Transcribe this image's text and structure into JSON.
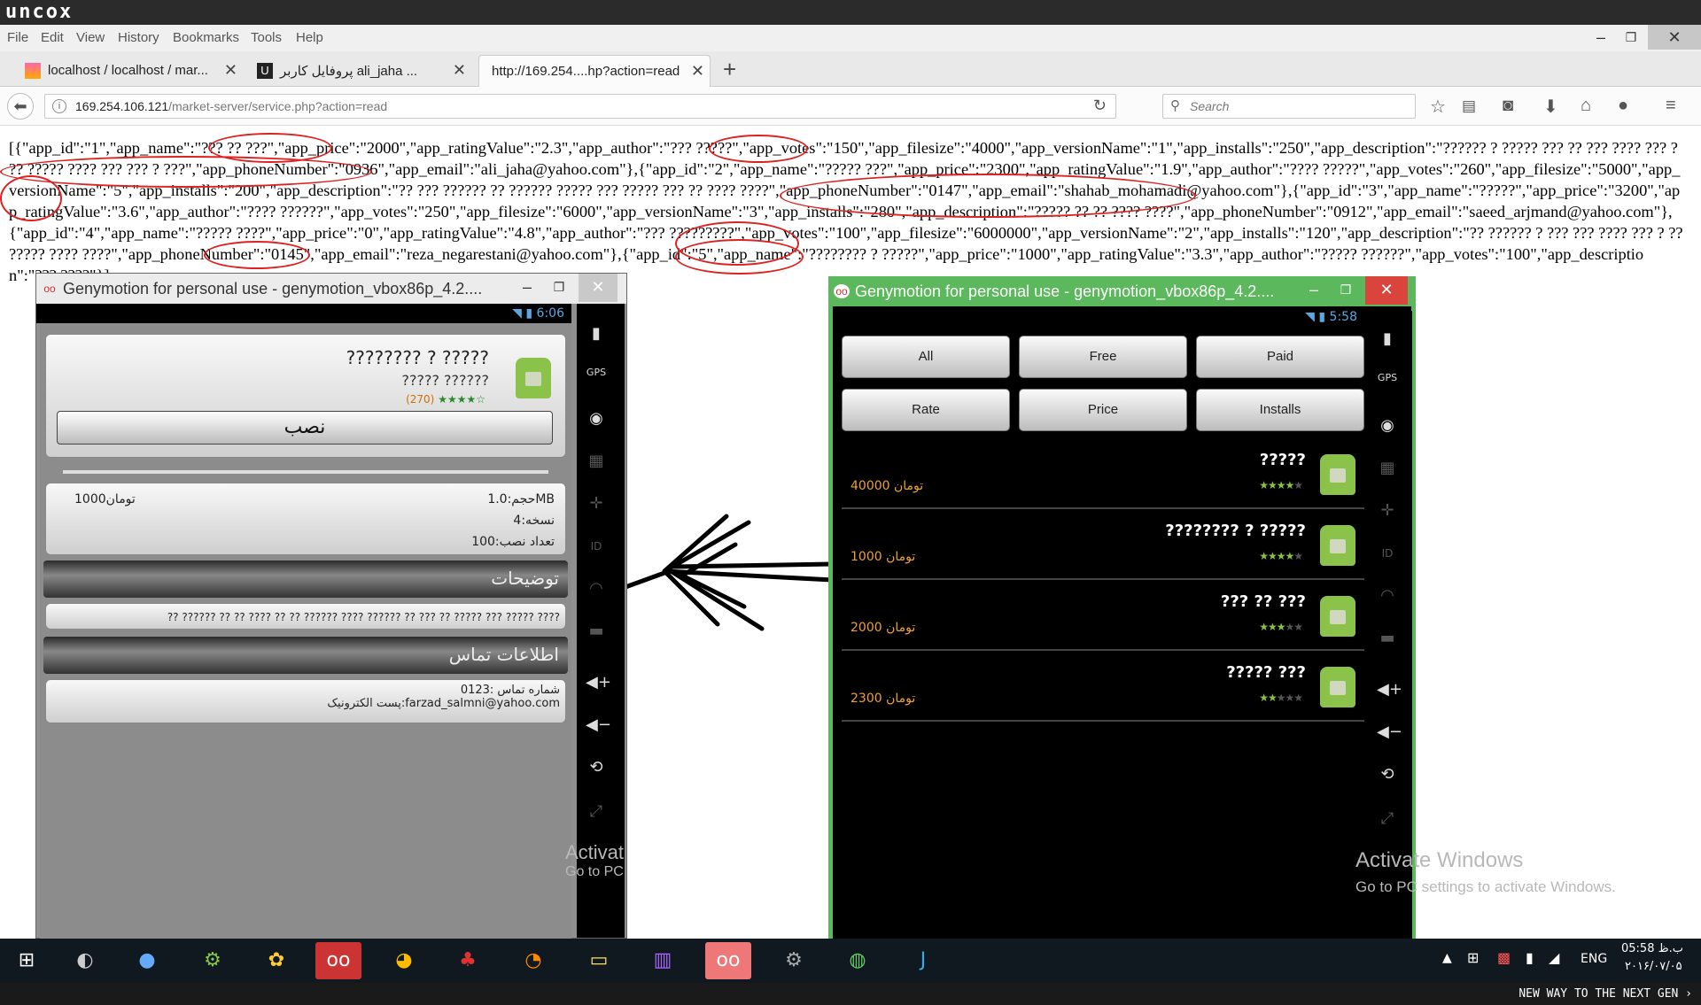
{
  "brand": "uncox",
  "footer": "NEW WAY TO THE NEXT GEN",
  "menu": [
    "File",
    "Edit",
    "View",
    "History",
    "Bookmarks",
    "Tools",
    "Help"
  ],
  "window_controls": [
    "–",
    "❐",
    "✕"
  ],
  "tabs": [
    {
      "title": "localhost / localhost / mar...",
      "close": "✕"
    },
    {
      "title": "پروفایل کاربر ali_jaha ...",
      "close": "✕"
    },
    {
      "title": "http://169.254....hp?action=read",
      "close": "✕"
    }
  ],
  "new_tab": "+",
  "url": {
    "host": "169.254.106.121",
    "path": "/market-server/service.php?action=read"
  },
  "search_placeholder": "Search",
  "json_text": "[{\"app_id\":\"1\",\"app_name\":\"??? ?? ???\",\"app_price\":\"2000\",\"app_ratingValue\":\"2.3\",\"app_author\":\"??? ?????\",\"app_votes\":\"150\",\"app_filesize\":\"4000\",\"app_versionName\":\"1\",\"app_installs\":\"250\",\"app_description\":\"?????? ? ????? ??? ?? ??? ???? ??? ? ?? ????? ???? ??? ??? ? ???\",\"app_phoneNumber\":\"0936\",\"app_email\":\"ali_jaha@yahoo.com\"},{\"app_id\":\"2\",\"app_name\":\"????? ???\",\"app_price\":\"2300\",\"app_ratingValue\":\"1.9\",\"app_author\":\"???? ?????\",\"app_votes\":\"260\",\"app_filesize\":\"5000\",\"app_versionName\":\"5\",\"app_installs\":\"200\",\"app_description\":\"?? ??? ?????? ?? ?????? ????? ??? ????? ??? ?? ???? ????\",\"app_phoneNumber\":\"0147\",\"app_email\":\"shahab_mohamadi@yahoo.com\"},{\"app_id\":\"3\",\"app_name\":\"?????\",\"app_price\":\"3200\",\"app_ratingValue\":\"3.6\",\"app_author\":\"???? ??????\",\"app_votes\":\"250\",\"app_filesize\":\"6000\",\"app_versionName\":\"3\",\"app_installs\":\"280\",\"app_description\":\"????? ?? ?? ???? ????\",\"app_phoneNumber\":\"0912\",\"app_email\":\"saeed_arjmand@yahoo.com\"},{\"app_id\":\"4\",\"app_name\":\"????? ????\",\"app_price\":\"0\",\"app_ratingValue\":\"4.8\",\"app_author\":\"??? ?????????\",\"app_votes\":\"100\",\"app_filesize\":\"6000000\",\"app_versionName\":\"2\",\"app_installs\":\"120\",\"app_description\":\"?? ?????? ? ??? ??? ???? ??? ? ?? ????? ???? ????\",\"app_phoneNumber\":\"0145\",\"app_email\":\"reza_negarestani@yahoo.com\"},{\"app_id\":\"5\",\"app_name\":\"???????? ? ?????\",\"app_price\":\"1000\",\"app_ratingValue\":\"3.3\",\"app_author\":\"????? ??????\",\"app_votes\":\"100\",\"app_description\":\"??? ????\"}]",
  "emu_title": "Genymotion for personal use - genymotion_vbox86p_4.2....",
  "left_emulator": {
    "time": "6:06",
    "app_name": "???????? ? ?????",
    "author": "????? ??????",
    "votes": "(270)",
    "rating": 3.5,
    "install_button": "نصب",
    "size": "حجم:1.0MB",
    "price": "1000تومان",
    "version": "نسخه:4",
    "installs": "تعداد نصب:100",
    "description_header": "توضیحات",
    "description": "?? ?????? ?? ?? ???? ?? ?? ?????? ???? ?????? ?? ??? ?? ????? ??? ????? ????",
    "contact_header": "اطلاعات تماس",
    "phone": "شماره تماس :0123",
    "email": "پست الکترونیک:farzad_salmni@yahoo.com"
  },
  "right_emulator": {
    "time": "5:58",
    "filters": [
      "All",
      "Free",
      "Paid",
      "Rate",
      "Price",
      "Installs"
    ],
    "apps": [
      {
        "name": "?????",
        "price": "40000 تومان",
        "rating": 3.5
      },
      {
        "name": "???????? ? ?????",
        "price": "1000 تومان",
        "rating": 3.5
      },
      {
        "name": "??? ?? ???",
        "price": "2000 تومان",
        "rating": 2.5
      },
      {
        "name": "????? ???",
        "price": "2300 تومان",
        "rating": 2
      }
    ]
  },
  "watermark": {
    "title": "Activate Windows",
    "sub": "Go to PC settings to activate Windows.",
    "left_title": "Activat",
    "left_sub": "Go to PC"
  },
  "tray": {
    "lang": "ENG",
    "time": "05:58 ب.ظ",
    "date": "۲۰۱۶/۰۷/۰۵"
  },
  "colors": {
    "accent_green": "#5cb85c",
    "annotation_red": "#dd2222",
    "taskbar": "#101820"
  }
}
